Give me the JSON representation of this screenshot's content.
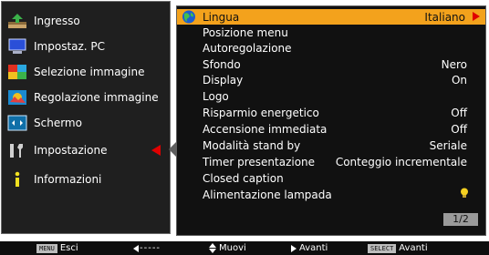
{
  "left_menu": {
    "items": [
      {
        "label": "Ingresso",
        "icon": "input-icon"
      },
      {
        "label": "Impostaz. PC",
        "icon": "pc-icon"
      },
      {
        "label": "Selezione immagine",
        "icon": "image-select-icon"
      },
      {
        "label": "Regolazione immagine",
        "icon": "image-adjust-icon"
      },
      {
        "label": "Schermo",
        "icon": "screen-icon"
      },
      {
        "label": "Impostazione",
        "icon": "wrench-icon",
        "selected": true
      },
      {
        "label": "Informazioni",
        "icon": "info-icon"
      }
    ]
  },
  "submenu": {
    "rows": [
      {
        "label": "Lingua",
        "value": "Italiano",
        "highlighted": true
      },
      {
        "label": "Posizione menu",
        "value": ""
      },
      {
        "label": "Autoregolazione",
        "value": ""
      },
      {
        "label": "Sfondo",
        "value": "Nero"
      },
      {
        "label": "Display",
        "value": "On"
      },
      {
        "label": "Logo",
        "value": ""
      },
      {
        "label": "Risparmio energetico",
        "value": "Off"
      },
      {
        "label": "Accensione immediata",
        "value": "Off"
      },
      {
        "label": "Modalità stand by",
        "value": "Seriale"
      },
      {
        "label": "Timer presentazione",
        "value": "Conteggio incrementale"
      },
      {
        "label": "Closed caption",
        "value": ""
      },
      {
        "label": "Alimentazione lampada",
        "value": "",
        "icon": "lamp-icon"
      }
    ],
    "page_indicator": "1/2"
  },
  "bottom_bar": {
    "menu_key": "MENU",
    "esci": "Esci",
    "back_dashes": "-----",
    "muovi": "Muovi",
    "avanti_1": "Avanti",
    "select_key": "SELECT",
    "avanti_2": "Avanti"
  },
  "colors": {
    "highlight": "#f3a21c",
    "arrow_red": "#e00000",
    "panel_bg": "#111111"
  }
}
